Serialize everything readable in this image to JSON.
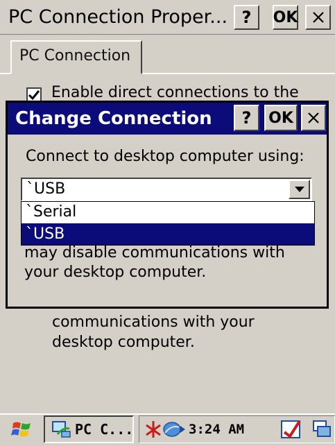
{
  "background_window": {
    "title": "PC Connection Proper...",
    "help_label": "?",
    "ok_label": "OK",
    "tab_label": "PC Connection",
    "checkbox_label": "Enable direct connections to the",
    "lower_text_line1": "communications with your",
    "lower_text_line2": "desktop computer."
  },
  "dialog": {
    "title": "Change Connection",
    "help_label": "?",
    "ok_label": "OK",
    "prompt": "Connect to desktop computer using:",
    "combo_value": "`USB",
    "options": [
      {
        "label": "`Serial",
        "selected": false
      },
      {
        "label": "`USB",
        "selected": true
      }
    ],
    "note_line1": "may disable communications with",
    "note_line2": "your desktop computer."
  },
  "taskbar": {
    "task_label": "PC C...",
    "clock": "3:24 AM"
  },
  "colors": {
    "title_bar": "#0b0b7a",
    "face": "#d4d0c8",
    "selection": "#0b0b7a"
  },
  "icons": [
    "close-icon",
    "dropdown-arrow-icon",
    "start-icon",
    "pc-connection-icon",
    "network-icon",
    "input-panel-icon",
    "desktop-icon"
  ]
}
